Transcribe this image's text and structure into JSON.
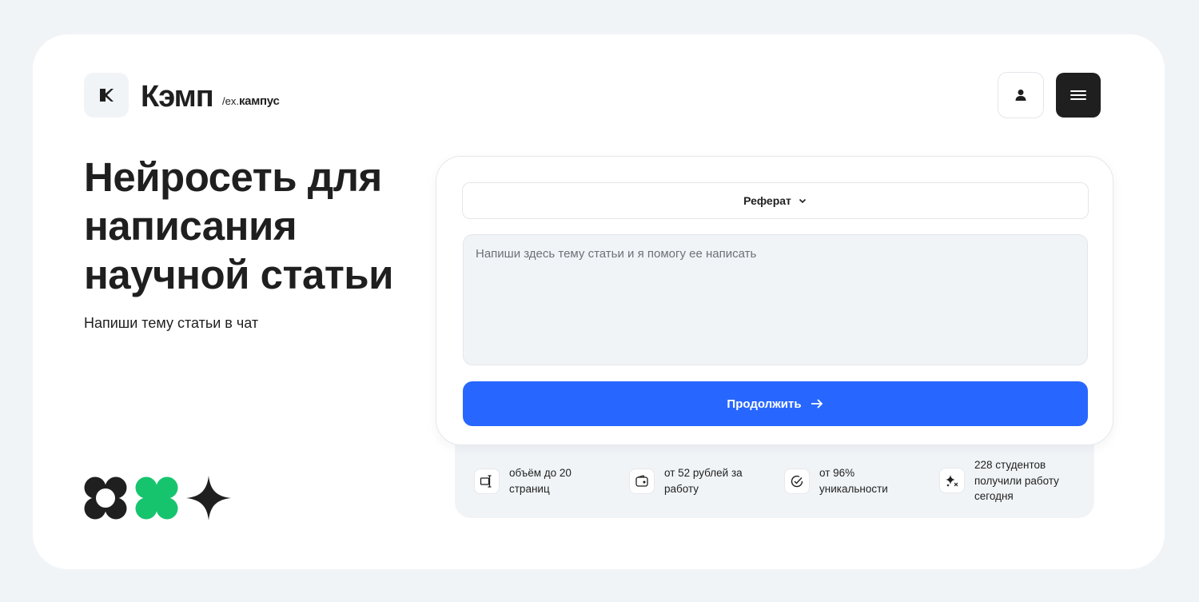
{
  "header": {
    "brand": "Кэмп",
    "brand_ex": "/ex.",
    "brand_former": "кампус",
    "user_icon": "user-icon",
    "menu_icon": "hamburger-menu-icon"
  },
  "hero": {
    "title": "Нейросеть для написания научной статьи",
    "subtitle": "Напиши тему статьи в чат"
  },
  "form": {
    "type_selected": "Реферат",
    "topic_value": "",
    "topic_placeholder": "Напиши здесь тему статьи и я помогу ее написать",
    "continue_label": "Продолжить"
  },
  "features": [
    {
      "icon": "text-cursor-icon",
      "text": "объём до 20 страниц"
    },
    {
      "icon": "wallet-icon",
      "text": "от 52 рублей за работу"
    },
    {
      "icon": "check-circle-icon",
      "text": "от 96% уникальности"
    },
    {
      "icon": "sparkles-icon",
      "text": "228 студентов получили работу сегодня"
    }
  ],
  "colors": {
    "accent": "#2767ff",
    "dark": "#1f1f1f",
    "green": "#16c46e",
    "background": "#f1f4f7"
  }
}
